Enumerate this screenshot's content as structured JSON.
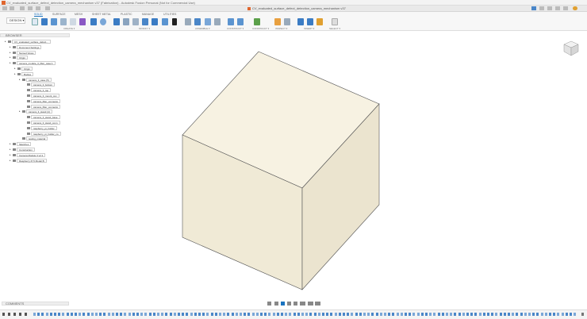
{
  "window": {
    "title": "CV_evaluated_surface_defect_detection_camera_mechanism v37 (Fabrication) - Autodesk Fusion Personal (Not for Commercial Use)",
    "document_title": "CV_evaluated_surface_defect_detection_camera_mechanism v37"
  },
  "ribbon": {
    "workspace": "DESIGN ▾",
    "tabs": [
      "SOLID",
      "SURFACE",
      "MESH",
      "SHEET METAL",
      "PLASTIC",
      "MANAGE",
      "UTILITIES"
    ],
    "groups": [
      "CREATE ▾",
      "MODIFY ▾",
      "ASSEMBLE ▾",
      "CONSTRUCT ▾",
      "INSPECT ▾",
      "INSERT ▾",
      "SELECT ▾"
    ]
  },
  "browser": {
    "title": "BROWSER",
    "nodes": [
      {
        "label": "CV_evaluated_surface_defect...",
        "depth": 0
      },
      {
        "label": "Document Settings",
        "depth": 1
      },
      {
        "label": "Named Views",
        "depth": 1
      },
      {
        "label": "Origin",
        "depth": 1
      },
      {
        "label": "camera_module_3_filter_case:1",
        "depth": 1
      },
      {
        "label": "Origin",
        "depth": 2
      },
      {
        "label": "Bodies",
        "depth": 2
      },
      {
        "label": "camera_3_case (5)",
        "depth": 3
      },
      {
        "label": "camera_3_bottom",
        "depth": 4
      },
      {
        "label": "camera_3_top",
        "depth": 4
      },
      {
        "label": "camera_3_mount_cov",
        "depth": 4
      },
      {
        "label": "camera_filter_connecto",
        "depth": 4
      },
      {
        "label": "camera_filter_connecto",
        "depth": 4
      },
      {
        "label": "camera_3_stand (4)",
        "depth": 3
      },
      {
        "label": "camera_3_stand_base",
        "depth": 4
      },
      {
        "label": "camera_3_stand_conn",
        "depth": 4
      },
      {
        "label": "raspberry_pi_holder",
        "depth": 4
      },
      {
        "label": "raspberry_pi_holder_co",
        "depth": 4
      },
      {
        "label": "testing_material",
        "depth": 3
      },
      {
        "label": "Sketches",
        "depth": 1
      },
      {
        "label": "Construction",
        "depth": 1
      },
      {
        "label": "Camera Module 3 v2:1",
        "depth": 1
      },
      {
        "label": "Raspberry Pi 5 Model B",
        "depth": 1
      }
    ]
  },
  "comments": {
    "label": "COMMENTS"
  },
  "colors": {
    "accent": "#1a73c0",
    "cube_top": "#f7f2e2",
    "cube_left": "#f0ead6",
    "cube_right": "#ebe4cf"
  }
}
